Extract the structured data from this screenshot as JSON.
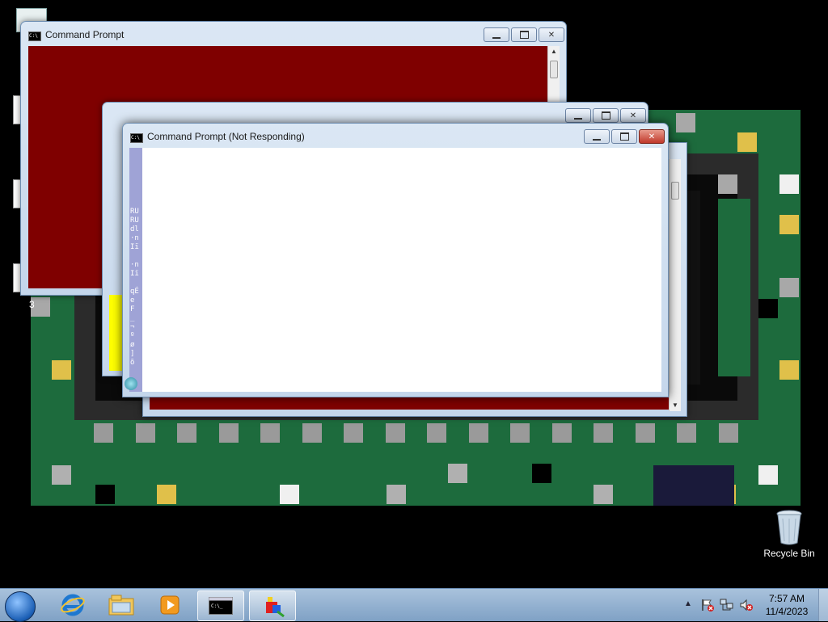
{
  "desktop": {
    "recycle_bin_label": "Recycle Bin",
    "edge_icon_label": "3"
  },
  "windows": {
    "back": {
      "title": "Command Prompt",
      "background": "#7f0000"
    },
    "middle": {
      "background": "#7f0000"
    },
    "front": {
      "title": "Command Prompt (Not Responding)",
      "console_text": "RU\nRU\ndl\n·n\nIï\n\n·n\nIï\n\nqÉ\ne\nF\n_\n¬\nº\nø\n]\nõ"
    }
  },
  "taskbar": {
    "clock_time": "7:57 AM",
    "clock_date": "11/4/2023",
    "pinned": [
      "internet-explorer-icon",
      "windows-explorer-icon",
      "media-player-icon",
      "command-prompt-icon",
      "paint-3d-app-icon"
    ]
  },
  "colors": {
    "console_red": "#7f0000",
    "board_green": "#1d6b3d",
    "taskbar": "#8fb0d3"
  }
}
